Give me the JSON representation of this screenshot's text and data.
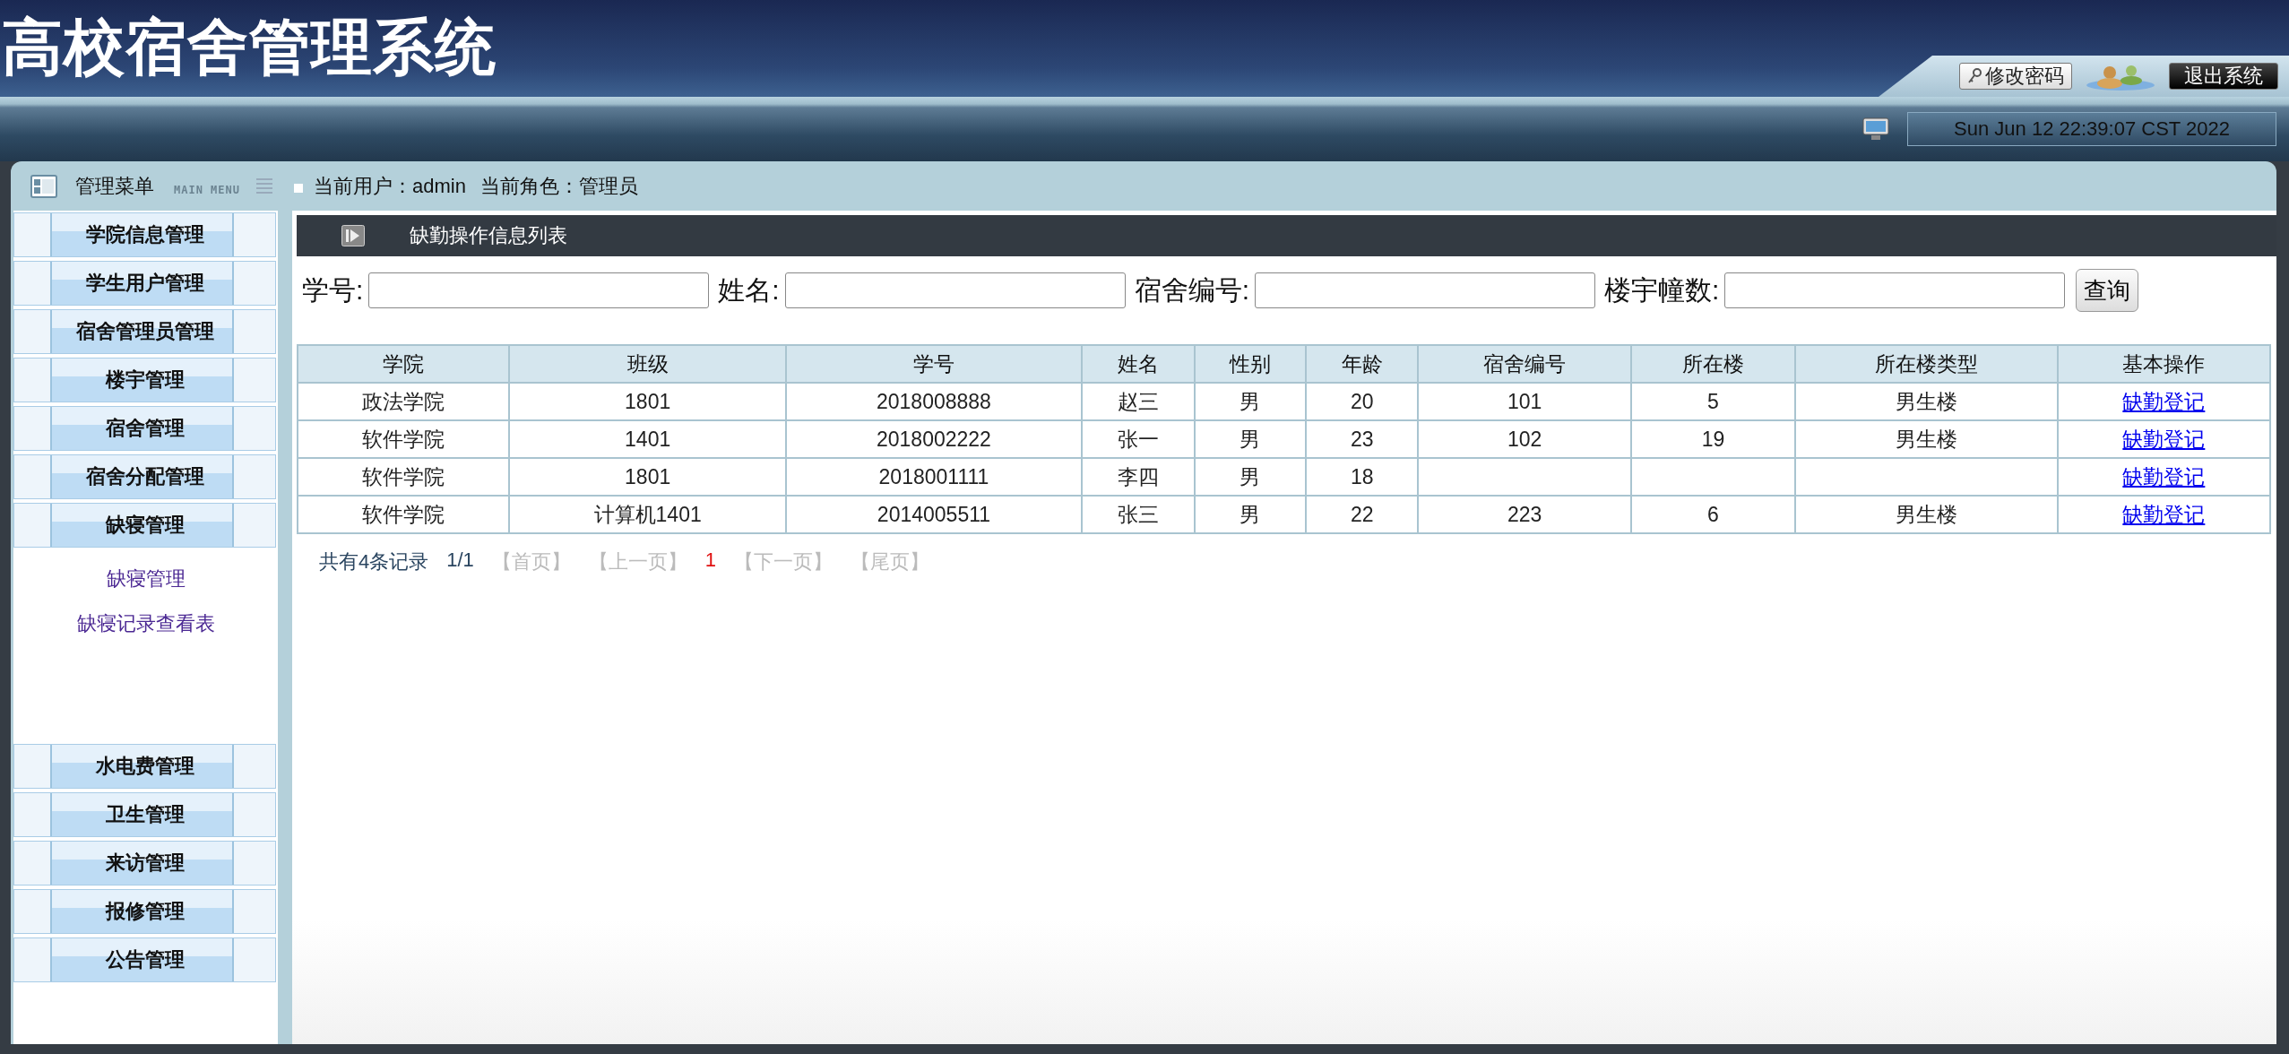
{
  "header": {
    "title": "高校宿舍管理系统",
    "buttons": [
      {
        "kind": "password",
        "label": "修改密码"
      },
      {
        "kind": "logout",
        "label": "退出系统"
      }
    ],
    "datetime": "Sun Jun 12 22:39:07 CST 2022"
  },
  "menu_bar": {
    "title": "管理菜单",
    "subtitle": "MAIN MENU",
    "current_user": "当前用户：admin",
    "current_role": "当前角色：管理员"
  },
  "sidebar": {
    "items": [
      {
        "label": "学院信息管理"
      },
      {
        "label": "学生用户管理"
      },
      {
        "label": "宿舍管理员管理"
      },
      {
        "label": "楼宇管理"
      },
      {
        "label": "宿舍管理"
      },
      {
        "label": "宿舍分配管理"
      },
      {
        "label": "缺寝管理",
        "children": [
          {
            "label": "缺寝管理"
          },
          {
            "label": "缺寝记录查看表"
          }
        ]
      },
      {
        "label": "水电费管理"
      },
      {
        "label": "卫生管理"
      },
      {
        "label": "来访管理"
      },
      {
        "label": "报修管理"
      },
      {
        "label": "公告管理"
      }
    ]
  },
  "panel": {
    "title": "缺勤操作信息列表",
    "search": {
      "fields": [
        {
          "label": "学号:"
        },
        {
          "label": "姓名:"
        },
        {
          "label": "宿舍编号:"
        },
        {
          "label": "楼宇幢数:"
        }
      ],
      "button": "查询"
    },
    "table": {
      "columns": [
        "学院",
        "班级",
        "学号",
        "姓名",
        "性别",
        "年龄",
        "宿舍编号",
        "所在楼",
        "所在楼类型",
        "基本操作"
      ],
      "rows": [
        {
          "college": "政法学院",
          "class": "1801",
          "student_id": "2018008888",
          "name": "赵三",
          "gender": "男",
          "age": "20",
          "dorm_no": "101",
          "building": "5",
          "building_type": "男生楼",
          "action": "缺勤登记"
        },
        {
          "college": "软件学院",
          "class": "1401",
          "student_id": "2018002222",
          "name": "张一",
          "gender": "男",
          "age": "23",
          "dorm_no": "102",
          "building": "19",
          "building_type": "男生楼",
          "action": "缺勤登记"
        },
        {
          "college": "软件学院",
          "class": "1801",
          "student_id": "2018001111",
          "name": "李四",
          "gender": "男",
          "age": "18",
          "action": "缺勤登记"
        },
        {
          "college": "软件学院",
          "class": "计算机1401",
          "student_id": "2014005511",
          "name": "张三",
          "gender": "男",
          "age": "22",
          "dorm_no": "223",
          "building": "6",
          "building_type": "男生楼",
          "action": "缺勤登记"
        }
      ]
    },
    "pager": {
      "summary": "共有4条记录",
      "page_info": "1/1",
      "items": [
        {
          "kind": "link",
          "label": "【首页】",
          "disabled": true
        },
        {
          "kind": "link",
          "label": "【上一页】",
          "disabled": true
        },
        {
          "kind": "current",
          "label": "1"
        },
        {
          "kind": "link",
          "label": "【下一页】",
          "disabled": true
        },
        {
          "kind": "link",
          "label": "【尾页】",
          "disabled": true
        }
      ]
    }
  }
}
